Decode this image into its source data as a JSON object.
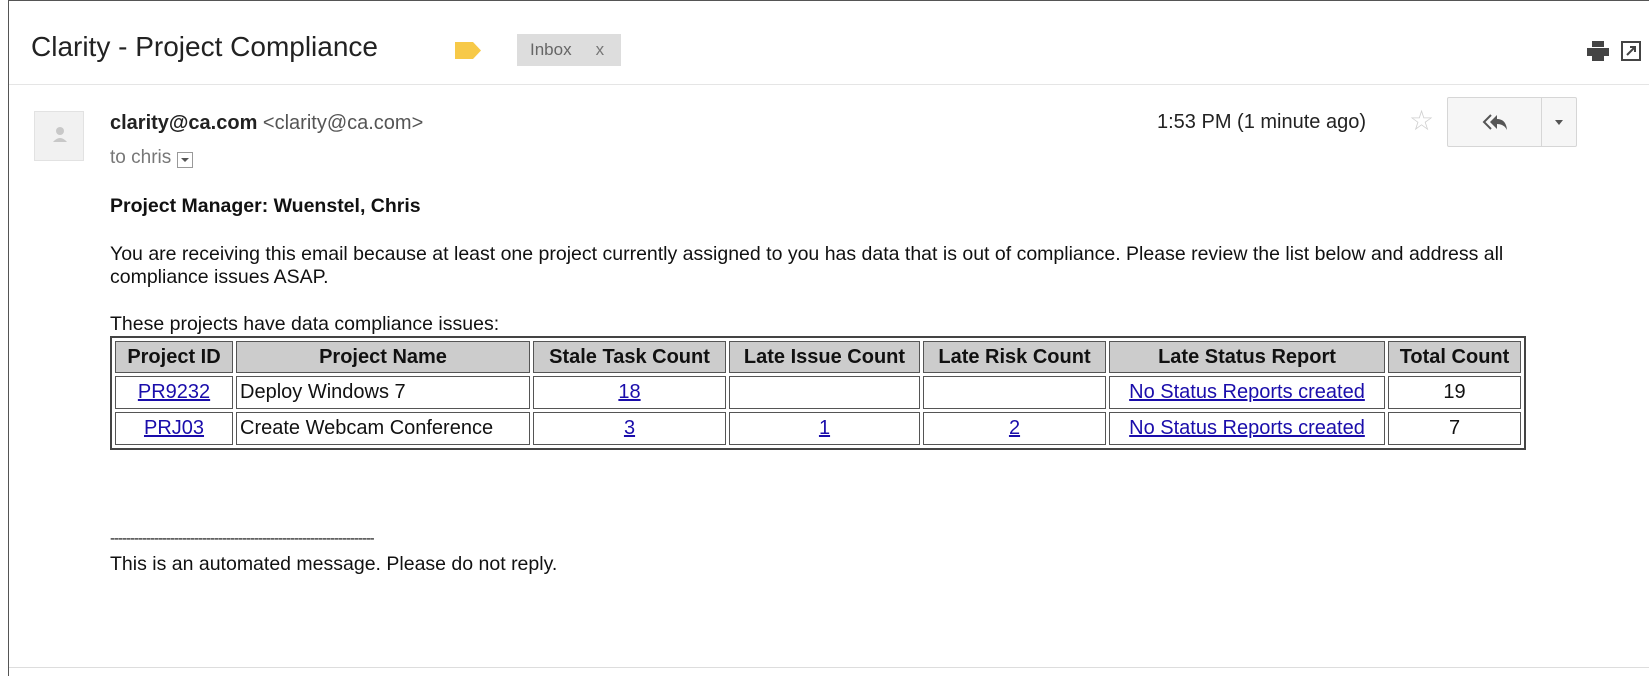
{
  "email": {
    "subject": "Clarity - Project Compliance",
    "label_chip": "Inbox",
    "label_chip_close": "x",
    "sender_name": "clarity@ca.com",
    "sender_email": "<clarity@ca.com>",
    "to": "to chris",
    "time": "1:53 PM (1 minute ago)",
    "star_glyph": "☆",
    "label_color": "#f7c948"
  },
  "body": {
    "project_manager": "Project Manager: Wuenstel, Chris",
    "intro": "You are receiving this email because at least one project currently assigned to you has data that is out of compliance. Please review the list below and address all compliance issues ASAP.",
    "table_caption": "These projects have data compliance issues:",
    "divider": "------------------------------------------------------------------",
    "footer": "This is an automated message. Please do not reply."
  },
  "table": {
    "headers": [
      "Project ID",
      "Project Name",
      "Stale Task Count",
      "Late Issue Count",
      "Late Risk Count",
      "Late Status Report",
      "Total Count"
    ],
    "rows": [
      {
        "id": "PR9232",
        "name": "Deploy Windows 7",
        "stale": "18",
        "issue": "",
        "risk": "",
        "status": "No Status Reports created",
        "total": "19"
      },
      {
        "id": "PRJ03",
        "name": "Create Webcam Conference",
        "stale": "3",
        "issue": "1",
        "risk": "2",
        "status": "No Status Reports created",
        "total": "7"
      }
    ]
  },
  "icons": [
    "label-tag-icon",
    "print-icon",
    "new-window-icon",
    "avatar-icon",
    "star-icon",
    "reply-all-icon",
    "chevron-down-icon"
  ]
}
